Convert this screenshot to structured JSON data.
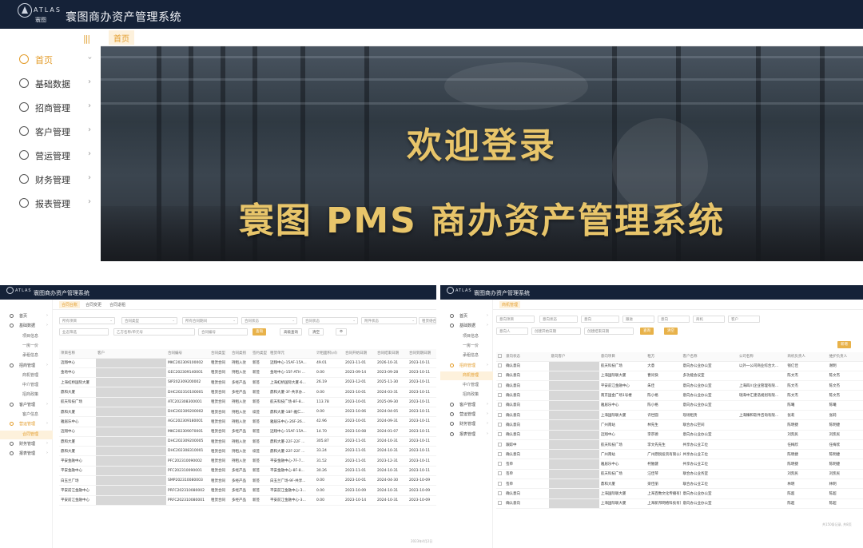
{
  "app": {
    "logo_text": "ATLAS",
    "logo_cn": "寰图",
    "title": "寰图商办资产管理系统"
  },
  "colors": {
    "header_bg": "#152238",
    "accent": "#e39c2a",
    "banner_text": "#e8c56a"
  },
  "big": {
    "collapse_icon": "|||",
    "menu": [
      {
        "label": "首页",
        "icon": "home-icon",
        "active": true
      },
      {
        "label": "基础数据",
        "icon": "database-icon"
      },
      {
        "label": "招商管理",
        "icon": "handshake-icon"
      },
      {
        "label": "客户管理",
        "icon": "customer-icon"
      },
      {
        "label": "营运管理",
        "icon": "operations-icon"
      },
      {
        "label": "财务管理",
        "icon": "finance-icon"
      },
      {
        "label": "报表管理",
        "icon": "report-icon"
      }
    ],
    "tab": "首页",
    "banner": {
      "welcome": "欢迎登录",
      "system": "寰图 PMS 商办资产管理系统"
    }
  },
  "left_mini": {
    "tabs": [
      "合同台账",
      "合同变更",
      "合同退租"
    ],
    "sidebar": [
      {
        "label": "首页",
        "type": "item"
      },
      {
        "label": "基础数据",
        "type": "item"
      },
      {
        "label": "项目信息",
        "type": "sub"
      },
      {
        "label": "一房一价",
        "type": "sub"
      },
      {
        "label": "承租信息",
        "type": "sub"
      },
      {
        "label": "招商管理",
        "type": "item"
      },
      {
        "label": "商机管理",
        "type": "sub"
      },
      {
        "label": "中介管理",
        "type": "sub"
      },
      {
        "label": "招商政策",
        "type": "sub"
      },
      {
        "label": "客户管理",
        "type": "item"
      },
      {
        "label": "客户信息",
        "type": "sub"
      },
      {
        "label": "营运管理",
        "type": "item",
        "active": true
      },
      {
        "label": "合同管理",
        "type": "sub",
        "active": true
      },
      {
        "label": "财务管理",
        "type": "item"
      },
      {
        "label": "报表管理",
        "type": "item"
      }
    ],
    "filters_row1": [
      "所有项目",
      "合同类型",
      "所有合同期间",
      "合同状态",
      "合同状态",
      "附件状态",
      "租赁组合"
    ],
    "filters_row2": [
      "业态筛选",
      "乙方名称/单元号",
      "合同编号"
    ],
    "buttons": {
      "search": "查询",
      "advanced": "高级查询",
      "clear": "清空",
      "settings": "⚙"
    },
    "columns": [
      "项目名称",
      "客户",
      "合同编号",
      "合同类型",
      "合同类别",
      "签约类型",
      "租赁单元",
      "计租面积(㎡)",
      "合同开始日期",
      "合同结束日期",
      "合同到期日期"
    ],
    "rows": [
      [
        "迈翔中心",
        "",
        "MKC202309100002",
        "租赁合同",
        "持租入驻",
        "新签",
        "迈翔中心-15AF-15A...",
        "49.01",
        "2023-11-01",
        "2026-10-31",
        "2023-10-11"
      ],
      [
        "金地中心",
        "",
        "GEC202309140001",
        "租赁合同",
        "持租入驻",
        "新签",
        "金地中心-15F-ATH ...",
        "0.00",
        "2023-09-14",
        "2023-09-28",
        "2023-10-11"
      ],
      [
        "上海虹桥国际大厦",
        "",
        "SIP202309200002",
        "租赁合同",
        "多经产品",
        "新签",
        "上海虹桥国际大厦-6...",
        "26.19",
        "2023-12-01",
        "2025-11-30",
        "2023-10-11"
      ],
      [
        "鼎和大厦",
        "",
        "DHC202310100001",
        "租赁合同",
        "多经产品",
        "新签",
        "鼎和大厦-3F-共享办...",
        "0.00",
        "2023-10-01",
        "2024-03-31",
        "2023-10-11"
      ],
      [
        "航天科技广场",
        "",
        "ATC202308300001",
        "租赁合同",
        "持租入驻",
        "新签",
        "航天科技广场-8F-8...",
        "113.78",
        "2023-10-01",
        "2025-09-30",
        "2023-10-11"
      ],
      [
        "鼎和大厦",
        "",
        "DHC202309200002",
        "租赁合同",
        "持租入驻",
        "续签",
        "鼎和大厦-18F-雅仁...",
        "0.00",
        "2023-10-06",
        "2024-04-05",
        "2023-10-11"
      ],
      [
        "雅居乐中心",
        "",
        "AGC202309180001",
        "租赁合同",
        "持租入驻",
        "新签",
        "雅居乐中心-26F-26...",
        "42.96",
        "2023-10-01",
        "2024-09-31",
        "2023-10-11"
      ],
      [
        "迈翔中心",
        "",
        "MKC202309070001",
        "租赁合同",
        "多经产品",
        "新签",
        "迈翔中心-15AF-15A...",
        "14.70",
        "2023-10-08",
        "2024-01-07",
        "2023-10-11"
      ],
      [
        "鼎和大厦",
        "",
        "DHC202309200005",
        "租赁合同",
        "持租入驻",
        "新签",
        "鼎和大厦-22F-22F ...",
        "305.87",
        "2023-11-01",
        "2024-10-31",
        "2023-10-11"
      ],
      [
        "鼎和大厦",
        "",
        "DHC202308310001",
        "租赁合同",
        "持租入驻",
        "续签",
        "鼎和大厦-22F-22F ...",
        "33.24",
        "2023-11-01",
        "2024-10-31",
        "2023-10-11"
      ],
      [
        "平安金融中心",
        "",
        "PFC202310090002",
        "租赁合同",
        "持租入驻",
        "新签",
        "平安金融中心-7F-7...",
        "31.52",
        "2023-11-01",
        "2023-12-31",
        "2023-10-11"
      ],
      [
        "平安金融中心",
        "",
        "PFC202310090001",
        "租赁合同",
        "多经产品",
        "新签",
        "平安金融中心-8F-8...",
        "30.26",
        "2023-11-01",
        "2024-10-31",
        "2023-10-11"
      ],
      [
        "白玉兰广场",
        "",
        "SMP202310080003",
        "租赁合同",
        "多经产品",
        "新签",
        "白玉兰广场-9F-共享...",
        "0.00",
        "2023-10-01",
        "2024-04-30",
        "2023-10-09"
      ],
      [
        "平安前江金融中心",
        "",
        "PRFC202310080002",
        "租赁合同",
        "多经产品",
        "新签",
        "平安前江金融中心-3...",
        "0.00",
        "2023-10-09",
        "2024-10-31",
        "2023-10-09"
      ],
      [
        "平安前江金融中心",
        "",
        "PRFC202310080001",
        "租赁合同",
        "多经产品",
        "新签",
        "平安前江金融中心-3...",
        "0.00",
        "2023-10-14",
        "2024-10-31",
        "2023-10-09"
      ]
    ],
    "footer": "2023年4月2日"
  },
  "right_mini": {
    "tabs": [
      "商机管理"
    ],
    "sidebar": [
      {
        "label": "首页",
        "type": "item"
      },
      {
        "label": "基础数据",
        "type": "item"
      },
      {
        "label": "项目信息",
        "type": "sub"
      },
      {
        "label": "一房一价",
        "type": "sub"
      },
      {
        "label": "承租信息",
        "type": "sub"
      },
      {
        "label": "招商管理",
        "type": "item",
        "active": true
      },
      {
        "label": "商机管理",
        "type": "sub",
        "active": true
      },
      {
        "label": "中介管理",
        "type": "sub"
      },
      {
        "label": "招商政策",
        "type": "sub"
      },
      {
        "label": "客户管理",
        "type": "item"
      },
      {
        "label": "营运管理",
        "type": "item"
      },
      {
        "label": "财务管理",
        "type": "item"
      },
      {
        "label": "报表管理",
        "type": "item"
      }
    ],
    "filters_row1": [
      "意向项目",
      "意向状态",
      "意向",
      "跟进",
      "意向",
      "商机",
      "客户"
    ],
    "filters_row2": [
      "意向人",
      "创建开始日期",
      "创建结束日期"
    ],
    "buttons": {
      "search": "查询",
      "clear": "清空",
      "add": "新增"
    },
    "columns": [
      "意向状态",
      "意向客户",
      "意向项目",
      "租方",
      "客户名称",
      "意向面积",
      "公司名称",
      "商机负责人",
      "维护负责人"
    ],
    "rows": [
      [
        "确认意向",
        "",
        "航天科技广场",
        "大意",
        "意向办公业办公室",
        "",
        "以外一公司商业综合大...",
        "钱亿佳",
        "谢明"
      ],
      [
        "确认意向",
        "",
        "上海国际联大厦",
        "曹问快",
        "多功能会议室",
        "",
        "",
        "陈文杰",
        "陈文杰"
      ],
      [
        "确认意向",
        "",
        "平安前江金融中心",
        "朱佳",
        "意向办公业办公室",
        "",
        "上海四川企业管理有限...",
        "陈文杰",
        "陈文杰"
      ],
      [
        "确认意向",
        "",
        "南京国金广场1号楼",
        "陈小格",
        "意向办公业办公室",
        "",
        "瑞海中汇建浩规划有限...",
        "陈文杰",
        "陈文杰"
      ],
      [
        "确认意向",
        "",
        "雅居乐中心",
        "陈小格",
        "意向办公业办公室",
        "",
        "",
        "陈曦",
        "陈曦"
      ],
      [
        "确认意向",
        "",
        "上海国际联大厦",
        "许世圆",
        "现场租赁",
        "",
        "上海臻和软件咨询有限...",
        "张莉",
        "张莉"
      ],
      [
        "确认意向",
        "",
        "广州南站",
        "林先生",
        "联合办公空间",
        "",
        "",
        "陈明捷",
        "陈明捷"
      ],
      [
        "确认意向",
        "",
        "迈翔中心",
        "李宗德",
        "意向办公业办公室",
        "",
        "",
        "刘凯民",
        "刘凯民"
      ],
      [
        "跟踪中",
        "",
        "航天科技广场",
        "李文先先生",
        "共享办公业工位",
        "",
        "",
        "任梅欣",
        "任梅欣"
      ],
      [
        "确认意向",
        "",
        "广州南站",
        "广州鼎锐投资有限公司",
        "共享办公业工位",
        "",
        "",
        "陈明捷",
        "陈明捷"
      ],
      [
        "签单",
        "",
        "雅居乐中心",
        "柯勉健",
        "共享办公业工位",
        "",
        "",
        "陈明捷",
        "陈明捷"
      ],
      [
        "签单",
        "",
        "航天科技广场",
        "汪佳琴",
        "联合办公业务室",
        "",
        "",
        "刘凯民",
        "刘凯民"
      ],
      [
        "签单",
        "",
        "鼎和大厦",
        "梁佳丽",
        "联合办公业工位",
        "",
        "",
        "林明",
        "林明"
      ],
      [
        "确认意向",
        "",
        "上海国际联大厦",
        "上海百数文化传播有限...",
        "意向办公业办公室",
        "",
        "",
        "陈超",
        "陈超"
      ],
      [
        "确认意向",
        "",
        "上海国际联大厦",
        "上海新邦网络科技有限...",
        "意向办公业办公室",
        "",
        "",
        "陈超",
        "陈超"
      ]
    ],
    "footer": "共150条记录, 共8页"
  }
}
